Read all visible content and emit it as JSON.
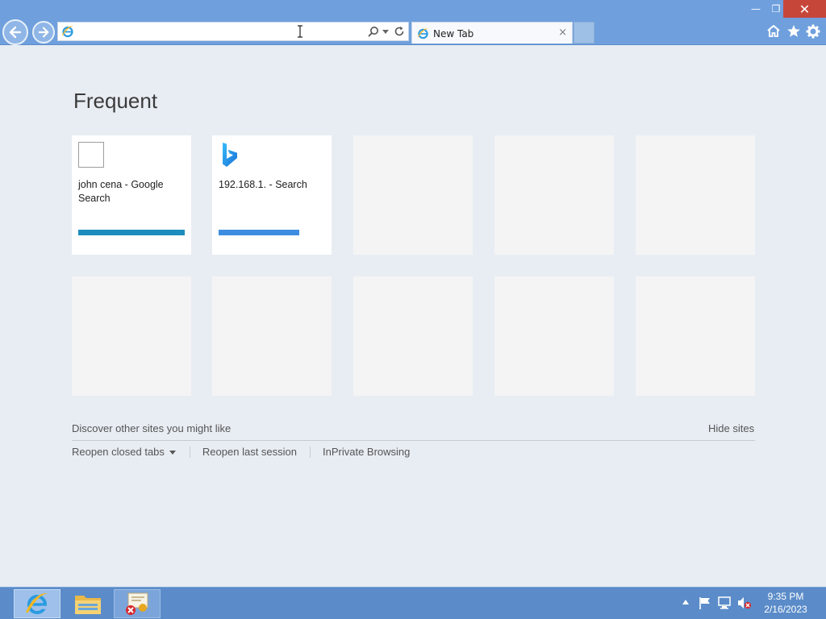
{
  "window": {
    "minimize_symbol": "—",
    "maximize_symbol": "❐",
    "close_symbol": "✕"
  },
  "address_bar": {
    "value": ""
  },
  "tabs": [
    {
      "title": "New Tab",
      "icon": "ie-icon",
      "close_symbol": "×"
    }
  ],
  "toolbar_icons": [
    "home-icon",
    "star-icon",
    "gear-icon"
  ],
  "content": {
    "heading": "Frequent",
    "tiles": [
      {
        "title": "john cena - Google Search",
        "icon": "blank-page-icon",
        "bar_color": "#1d8dbd"
      },
      {
        "title": "192.168.1. - Search",
        "icon": "bing-icon",
        "bar_color": "#3d8ee0"
      }
    ],
    "discover_text": "Discover other sites you might like",
    "hide_sites": "Hide sites",
    "links": {
      "reopen_closed_tabs": "Reopen closed tabs",
      "reopen_last_session": "Reopen last session",
      "inprivate": "InPrivate Browsing"
    }
  },
  "taskbar": {
    "apps": [
      "internet-explorer",
      "file-explorer",
      "certificate-manager"
    ],
    "clock": {
      "time": "9:35 PM",
      "date": "2/16/2023"
    }
  },
  "colors": {
    "titlebar": "#6fa0dd",
    "page_background": "#e8edf3",
    "taskbar": "#5b8cc9",
    "close_button": "#c7463a"
  }
}
